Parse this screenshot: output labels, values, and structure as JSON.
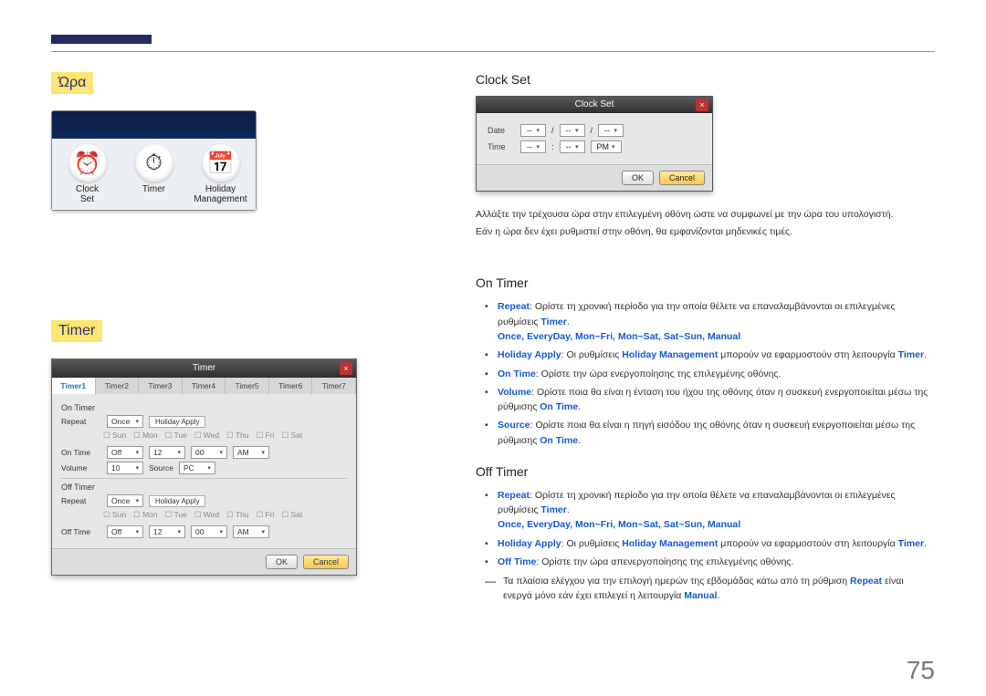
{
  "page_number": "75",
  "left": {
    "heading1": "Ώρα",
    "heading2": "Timer",
    "icons": {
      "clock": {
        "glyph": "⏰",
        "label": "Clock\nSet"
      },
      "timer": {
        "glyph": "⏱",
        "label": "Timer"
      },
      "holiday": {
        "glyph": "📅",
        "label": "Holiday\nManagement"
      }
    },
    "timer_dialog": {
      "title": "Timer",
      "close": "×",
      "tabs": [
        "Timer1",
        "Timer2",
        "Timer3",
        "Timer4",
        "Timer5",
        "Timer6",
        "Timer7"
      ],
      "on_timer_label": "On Timer",
      "off_timer_label": "Off Timer",
      "repeat_label": "Repeat",
      "repeat_value": "Once",
      "holiday_apply": "Holiday Apply",
      "days": [
        "Sun",
        "Mon",
        "Tue",
        "Wed",
        "Thu",
        "Fri",
        "Sat"
      ],
      "on_time_label": "On Time",
      "on_time_state": "Off",
      "on_time_h": "12",
      "on_time_m": "00",
      "on_time_ampm": "AM",
      "volume_label": "Volume",
      "volume_value": "10",
      "source_label": "Source",
      "source_value": "PC",
      "off_time_label": "Off Time",
      "off_time_state": "Off",
      "off_time_h": "12",
      "off_time_m": "00",
      "off_time_ampm": "AM",
      "ok": "OK",
      "cancel": "Cancel"
    }
  },
  "right": {
    "clockset": {
      "heading": "Clock Set",
      "dialog": {
        "title": "Clock Set",
        "close": "×",
        "date_label": "Date",
        "time_label": "Time",
        "placeholder": "--",
        "pm": "PM",
        "slash": "/",
        "colon": ":",
        "ok": "OK",
        "cancel": "Cancel"
      },
      "para1": "Αλλάξτε την τρέχουσα ώρα στην επιλεγμένη οθόνη ώστε να συμφωνεί με την ώρα του υπολογιστή.",
      "para2": "Εάν η ώρα δεν έχει ρυθμιστεί στην οθόνη, θα εμφανίζονται μηδενικές τιμές."
    },
    "on_timer_heading": "On Timer",
    "off_timer_heading": "Off Timer",
    "kw": {
      "repeat": "Repeat",
      "timer": "Timer",
      "options": "Once, EveryDay, Mon~Fri, Mon~Sat, Sat~Sun, Manual",
      "holiday_apply": "Holiday Apply",
      "holiday_mgmt": "Holiday Management",
      "on_time": "On Time",
      "volume": "Volume",
      "source": "Source",
      "off_time": "Off Time",
      "manual": "Manual"
    },
    "on_bullets": {
      "repeat": ": Ορίστε τη χρονική περίοδο για την οποία θέλετε να επαναλαμβάνονται οι επιλεγμένες ρυθμίσεις ",
      "holiday_a": ": Οι ρυθμίσεις ",
      "holiday_b": " μπορούν να εφαρμοστούν στη λειτουργία ",
      "on_time": ": Ορίστε την ώρα ενεργοποίησης της επιλεγμένης οθόνης.",
      "volume_a": ": Ορίστε ποια θα είναι η ένταση του ήχου της οθόνης όταν η συσκευή ενεργοποιείται μέσω της ρύθμισης ",
      "source_a": ": Ορίστε ποια θα είναι η πηγή εισόδου της οθόνης όταν η συσκευή ενεργοποιείται μέσω της ρύθμισης "
    },
    "off_bullets": {
      "repeat": ": Ορίστε τη χρονική περίοδο για την οποία θέλετε να επαναλαμβάνονται οι επιλεγμένες ρυθμίσεις ",
      "holiday_a": ": Οι ρυθμίσεις ",
      "holiday_b": " μπορούν να εφαρμοστούν στη λειτουργία ",
      "off_time": ": Ορίστε την ώρα απενεργοποίησης της επιλεγμένης οθόνης."
    },
    "note_a": "Τα πλαίσια ελέγχου για την επιλογή ημερών της εβδομάδας κάτω από τη ρύθμιση ",
    "note_b": " είναι ενεργά μόνο εάν έχει επιλεγεί η λειτουργία ",
    "period": "."
  }
}
